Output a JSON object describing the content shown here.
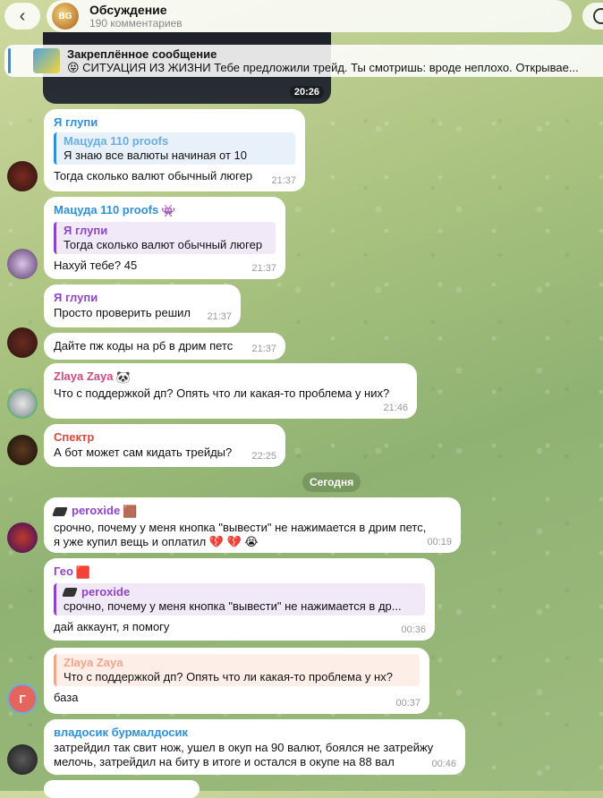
{
  "header": {
    "title": "Обсуждение",
    "subtitle": "190 комментариев",
    "avatar_text": "BG"
  },
  "pinned": {
    "title": "Закреплённое сообщение",
    "text": "😝 СИТУАЦИЯ ИЗ ЖИЗНИ  Тебе предложили трейд. Ты смотришь: вроде неплохо. Открывае..."
  },
  "media_time": "20:26",
  "date_separator": "Сегодня",
  "messages": [
    {
      "sender": "Я глупи",
      "reply_name": "Мацуда 110 proofs",
      "reply_text": "Я знаю все валюты начиная от 10",
      "text": "Тогда сколько валют обычный люгер",
      "time": "21:37"
    },
    {
      "sender": "Мацуда 110 proofs",
      "sender_tag": "👾",
      "reply_name": "Я глупи",
      "reply_text": "Тогда сколько валют обычный люгер",
      "text": "Нахуй тебе? 45",
      "time": "21:37"
    },
    {
      "sender": "Я глупи",
      "text": "Просто проверить решил",
      "time": "21:37"
    },
    {
      "text": "Дайте пж коды на рб в дрим петс",
      "time": "21:37"
    },
    {
      "sender": "Zlaya Zaya",
      "sender_tag": "🐼",
      "text": "Что с поддержкой дп? Опять что ли какая-то проблема у них?",
      "time": "21:46"
    },
    {
      "sender": "Спектр",
      "text": "А бот может сам кидать трейды?",
      "time": "22:25"
    },
    {
      "sender": "peroxide",
      "sender_tag": "🟫",
      "text": "срочно, почему у меня кнопка \"вывести\" не нажимается в дрим петс,\nя уже купил вещь и оплатил 💔 💔 😭",
      "time": "00:19"
    },
    {
      "sender": "Гео",
      "sender_tag": "🟥",
      "reply_name": "peroxide",
      "reply_text": "срочно, почему у меня кнопка \"вывести\" не нажимается в др...",
      "text": "дай аккаунт, я помогу",
      "time": "00:36"
    },
    {
      "reply_name": "Zlaya Zaya",
      "reply_text": "Что с поддержкой дп? Опять что ли какая-то проблема у нх?",
      "text": "база",
      "time": "00:37",
      "avatar_letter": "Г"
    },
    {
      "sender": "владосик бурмалдосик",
      "text": "затрейдил так свит нож, ушел в окуп на 90 валют, боялся не затрейжу\nмелочь, затрейдил на биту в итоге и остался в окупе на 88 вал",
      "time": "00:46"
    }
  ],
  "colors": {
    "blue_name": "#2f8fd8",
    "purple_name": "#8e45c4",
    "red_name": "#d9483b",
    "zaya_reply": "#f0a58a",
    "date_pill": "#6e8a56"
  }
}
